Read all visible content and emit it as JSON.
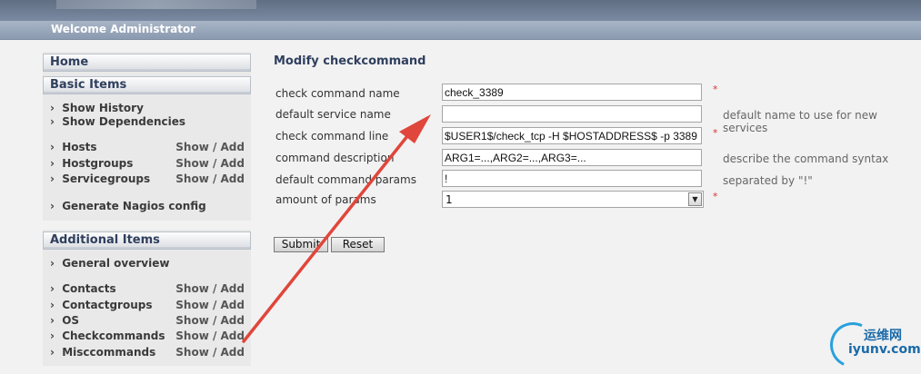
{
  "header": {
    "welcome": "Welcome Administrator"
  },
  "sidebar": {
    "home": "Home",
    "basic_title": "Basic Items",
    "basic_items": [
      {
        "label": "Show History",
        "action": ""
      },
      {
        "label": "Show Dependencies",
        "action": ""
      },
      {
        "label": "Hosts",
        "action": "Show / Add"
      },
      {
        "label": "Hostgroups",
        "action": "Show / Add"
      },
      {
        "label": "Servicegroups",
        "action": "Show / Add"
      },
      {
        "label": "Generate Nagios config",
        "action": ""
      }
    ],
    "additional_title": "Additional Items",
    "additional_items": [
      {
        "label": "General overview",
        "action": ""
      },
      {
        "label": "Contacts",
        "action": "Show / Add"
      },
      {
        "label": "Contactgroups",
        "action": "Show / Add"
      },
      {
        "label": "OS",
        "action": "Show / Add"
      },
      {
        "label": "Checkcommands",
        "action": "Show / Add"
      },
      {
        "label": "Misccommands",
        "action": "Show / Add"
      }
    ]
  },
  "form": {
    "title": "Modify checkcommand",
    "fields": [
      {
        "label": "check command name",
        "value": "check_3389",
        "required": "*",
        "hint": ""
      },
      {
        "label": "default service name",
        "value": "",
        "required": "",
        "hint": "default name to use for new services"
      },
      {
        "label": "check command line",
        "value": "$USER1$/check_tcp -H $HOSTADDRESS$ -p 3389",
        "required": "*",
        "hint": ""
      },
      {
        "label": "command description",
        "value": "ARG1=...,ARG2=...,ARG3=...",
        "required": "",
        "hint": "describe the command syntax"
      },
      {
        "label": "default command params",
        "value": "!",
        "required": "",
        "hint": "separated by \"!\""
      },
      {
        "label": "amount of params",
        "value": "1",
        "required": "*",
        "hint": ""
      }
    ],
    "submit_label": "Submit",
    "reset_label": "Reset"
  },
  "watermark": {
    "line1": "运维网",
    "line2": "iyunv.com"
  },
  "colors": {
    "annotation_arrow": "#e0463b",
    "header": "#6f7e94",
    "sidebar_head_text": "#2f3f5d"
  }
}
